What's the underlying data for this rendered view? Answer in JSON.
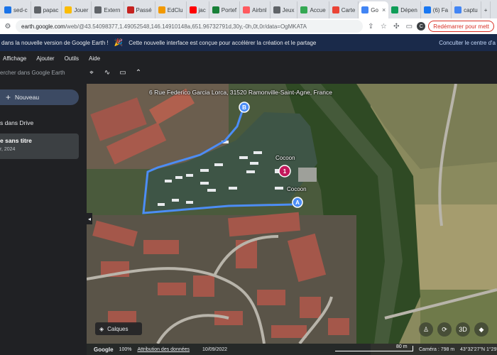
{
  "browser": {
    "tabs": [
      {
        "label": "sed-c",
        "icon": "doc-icon",
        "color": "#1a73e8"
      },
      {
        "label": "papac",
        "icon": "doc-icon",
        "color": "#5f6368"
      },
      {
        "label": "Jouer",
        "icon": "pacman-icon",
        "color": "#fbbc04"
      },
      {
        "label": "Extern",
        "icon": "globe-icon",
        "color": "#5f6368"
      },
      {
        "label": "Passé",
        "icon": "puzzle-icon",
        "color": "#c5221f"
      },
      {
        "label": "EdClu",
        "icon": "edclub-icon",
        "color": "#f29900"
      },
      {
        "label": "jac",
        "icon": "youtube-icon",
        "color": "#ff0000"
      },
      {
        "label": "Portef",
        "icon": "v-icon",
        "color": "#188038"
      },
      {
        "label": "Airbnl",
        "icon": "airbnb-icon",
        "color": "#ff5a5f"
      },
      {
        "label": "Jeux",
        "icon": "lock-icon",
        "color": "#5f6368"
      },
      {
        "label": "Accue",
        "icon": "drive-icon",
        "color": "#34a853"
      },
      {
        "label": "Carte",
        "icon": "maps-icon",
        "color": "#ea4335"
      },
      {
        "label": "Go",
        "icon": "earth-icon",
        "color": "#4285f4",
        "active": true
      },
      {
        "label": "Dépen",
        "icon": "sheets-icon",
        "color": "#0f9d58"
      },
      {
        "label": "(6) Fa",
        "icon": "facebook-icon",
        "color": "#1877f2"
      },
      {
        "label": "captu",
        "icon": "google-icon",
        "color": "#4285f4"
      }
    ],
    "url_domain": "earth.google.com",
    "url_path": "/web/@43.54098377,1.49052548,146.14910148a,651.96732791d,30y,-0h,0t,0r/data=OgMKATA",
    "restart_label": "Redémarrer pour mett"
  },
  "banner": {
    "text": "dans la nouvelle version de Google Earth !",
    "party_icon": "🎉",
    "message": "Cette nouvelle interface est conçue pour accélérer la création et le partage",
    "link": "Conculter le centre d'a"
  },
  "menu": [
    "Affichage",
    "Ajouter",
    "Outils",
    "Aide"
  ],
  "search": {
    "placeholder": "ercher dans Google Earth"
  },
  "sidebar": {
    "new_label": "Nouveau",
    "drive_title": "s dans Drive",
    "project_title": "e sans titre",
    "project_date": "r, 2024"
  },
  "map": {
    "address": "6 Rue Federico Garcia Lorca, 31520 Ramonville-Saint-Agne, France",
    "poi": [
      "Cocoon",
      "Cocoon"
    ],
    "marker_a": "A",
    "marker_b": "B",
    "poi_marker": "1",
    "layers_label": "Calques",
    "view_3d": "3D",
    "route_color": "#4c8df6"
  },
  "status": {
    "logo": "Google",
    "zoom": "100%",
    "attribution": "Attribution des données",
    "date": "10/09/2022",
    "scale": "80 m",
    "camera": "Caméra : 798 m",
    "coords": "43°32'27\"N 1°29'"
  }
}
